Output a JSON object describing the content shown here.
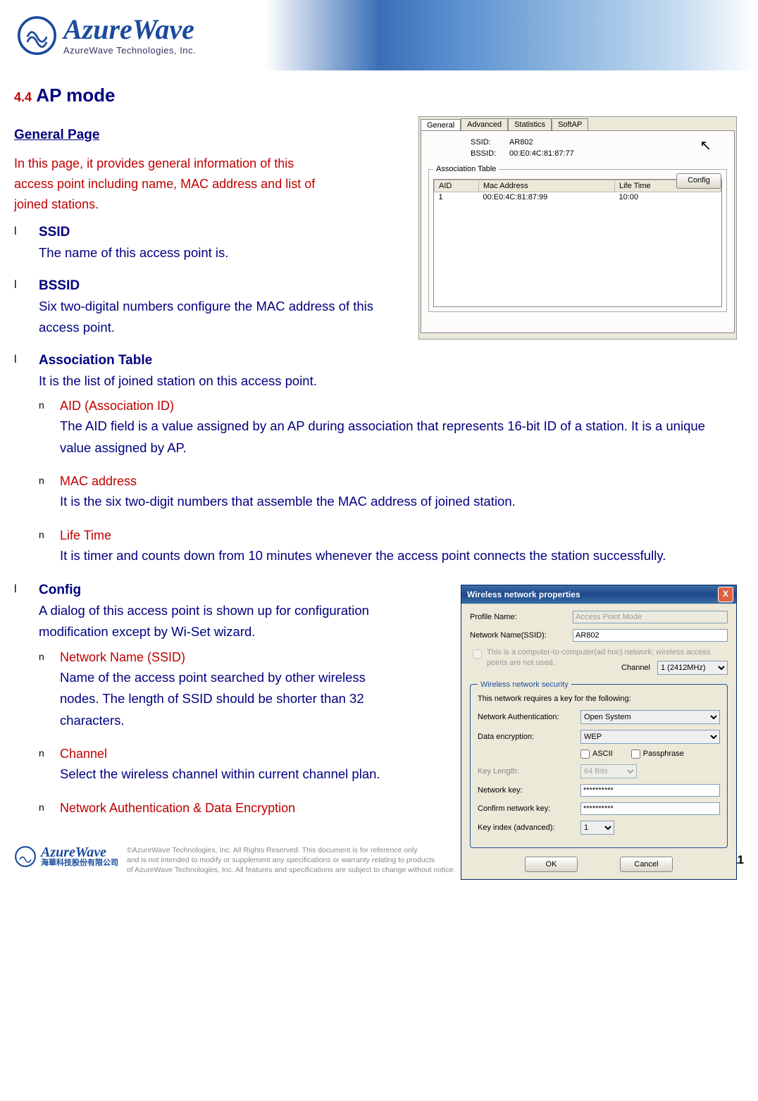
{
  "banner": {
    "brand": "AzureWave",
    "sub": "AzureWave  Technologies,  Inc."
  },
  "section": {
    "num": "4.4",
    "title": " AP mode"
  },
  "general": {
    "heading": "General Page",
    "intro": "In this page, it provides general information of this access point including name, MAC address and list of joined stations."
  },
  "items": {
    "ssid": {
      "term": "SSID",
      "text": "The name of this access point is."
    },
    "bssid": {
      "term": "BSSID",
      "text": "Six two-digital numbers configure the MAC address of this access point."
    },
    "assoc": {
      "term": "Association Table",
      "text": "It is the list of joined station on this access point."
    },
    "aid": {
      "term": "AID (Association ID)",
      "text": "The AID field is a value assigned by an AP during association that represents 16-bit ID of a station. It is a unique value assigned by AP."
    },
    "mac": {
      "term": "MAC address",
      "text": "It is the six two-digit numbers that assemble the MAC address of joined station."
    },
    "life": {
      "term": "Life Time",
      "text": "It is timer and counts down from 10 minutes whenever the access point connects the station successfully."
    },
    "config": {
      "term": "Config",
      "text": "A dialog of this access point is shown up for configuration modification except by Wi-Set wizard."
    },
    "nname": {
      "term": "Network Name (SSID)",
      "text": "Name of the access point searched by other wireless nodes. The length of SSID should be shorter than 32 characters."
    },
    "channel": {
      "term": "Channel",
      "text": "Select the wireless channel within current channel plan."
    },
    "netauth": {
      "term": "Network Authentication & Data Encryption"
    }
  },
  "shot1": {
    "tabs": [
      "General",
      "Advanced",
      "Statistics",
      "SoftAP"
    ],
    "ssid_lbl": "SSID:",
    "ssid_val": "AR802",
    "bssid_lbl": "BSSID:",
    "bssid_val": "00:E0:4C:81:87:77",
    "legend": "Association Table",
    "config_btn": "Config",
    "cols": [
      "AID",
      "Mac Address",
      "Life Time"
    ],
    "row": {
      "aid": "1",
      "mac": "00:E0:4C:81:87:99",
      "life": "10:00"
    }
  },
  "shot2": {
    "title": "Wireless network properties",
    "profile_lbl": "Profile Name:",
    "profile_val": "Access Point Mode",
    "ssid_lbl": "Network Name(SSID):",
    "ssid_val": "AR802",
    "adhoc_chk": "This is a computer-to-computer(ad hoc) network; wireless access points are not used.",
    "channel_lbl": "Channel",
    "channel_val": "1 (2412MHz)",
    "security_legend": "Wireless network security",
    "sec_text": "This network requires a key for the following:",
    "auth_lbl": "Network Authentication:",
    "auth_val": "Open System",
    "enc_lbl": "Data encryption:",
    "enc_val": "WEP",
    "ascii": "ASCII",
    "passphrase": "Passphrase",
    "keylen_lbl": "Key Length:",
    "keylen_val": "64 Bits",
    "nkey_lbl": "Network key:",
    "nkey_val": "**********",
    "ckey_lbl": "Confirm network key:",
    "ckey_val": "**********",
    "kidx_lbl": "Key index (advanced):",
    "kidx_val": "1",
    "ok": "OK",
    "cancel": "Cancel"
  },
  "footer": {
    "brand": "AzureWave",
    "cn": "海華科技股份有限公司",
    "text1": "©AzureWave Technologies, Inc. All Rights Reserved. This document is for reference only",
    "text2": "and is not intended to modify or supplement any specifications or  warranty relating to products",
    "text3": "of AzureWave Technologies, Inc.  All features and specifications are subject to change without notice.",
    "page": "4-11"
  }
}
